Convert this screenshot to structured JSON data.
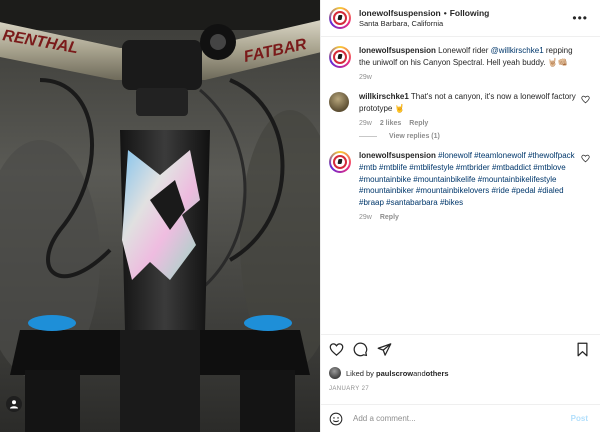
{
  "photo": {
    "bar_text_left": "RENTHAL",
    "bar_text_right": "FATBAR"
  },
  "header": {
    "username": "lonewolfsuspension",
    "separator": "•",
    "follow_status": "Following",
    "location": "Santa Barbara, California",
    "more_icon": "more-dots-icon"
  },
  "caption": {
    "username": "lonewolfsuspension",
    "text_before": "Lonewolf rider ",
    "mention": "@willkirschke1",
    "text_after": " repping the uniwolf on his Canyon Spectral. Hell yeah buddy. 🤘🏼👊🏼",
    "time": "29w"
  },
  "comments": [
    {
      "username": "willkirschke1",
      "text": "That's not a canyon, it's now a lonewolf factory prototype 🤘",
      "time": "29w",
      "likes": "2 likes",
      "reply": "Reply"
    },
    {
      "username": "lonewolfsuspension",
      "text": "#lonewolf #teamlonewolf #thewolfpack #mtb #mtblife #mtblifestyle #mtbrider #mtbaddict #mtblove #mountainbike #mountainbikelife #mountainbikelifestyle #mountainbiker #mountainbikelovers #ride #pedal #dialed #braap #santabarbara #bikes",
      "time": "29w",
      "reply": "Reply"
    }
  ],
  "view_replies": "View replies (1)",
  "likes": {
    "prefix": "Liked by ",
    "user": "paulscrow",
    "and": " and ",
    "others": "others"
  },
  "date": "JANUARY 27",
  "add_comment": {
    "placeholder": "Add a comment...",
    "post_label": "Post"
  },
  "colors": {
    "link": "#00376b",
    "muted": "#8e8e8e",
    "post_disabled": "#b2dffc",
    "brand_red": "#d42b3a"
  }
}
